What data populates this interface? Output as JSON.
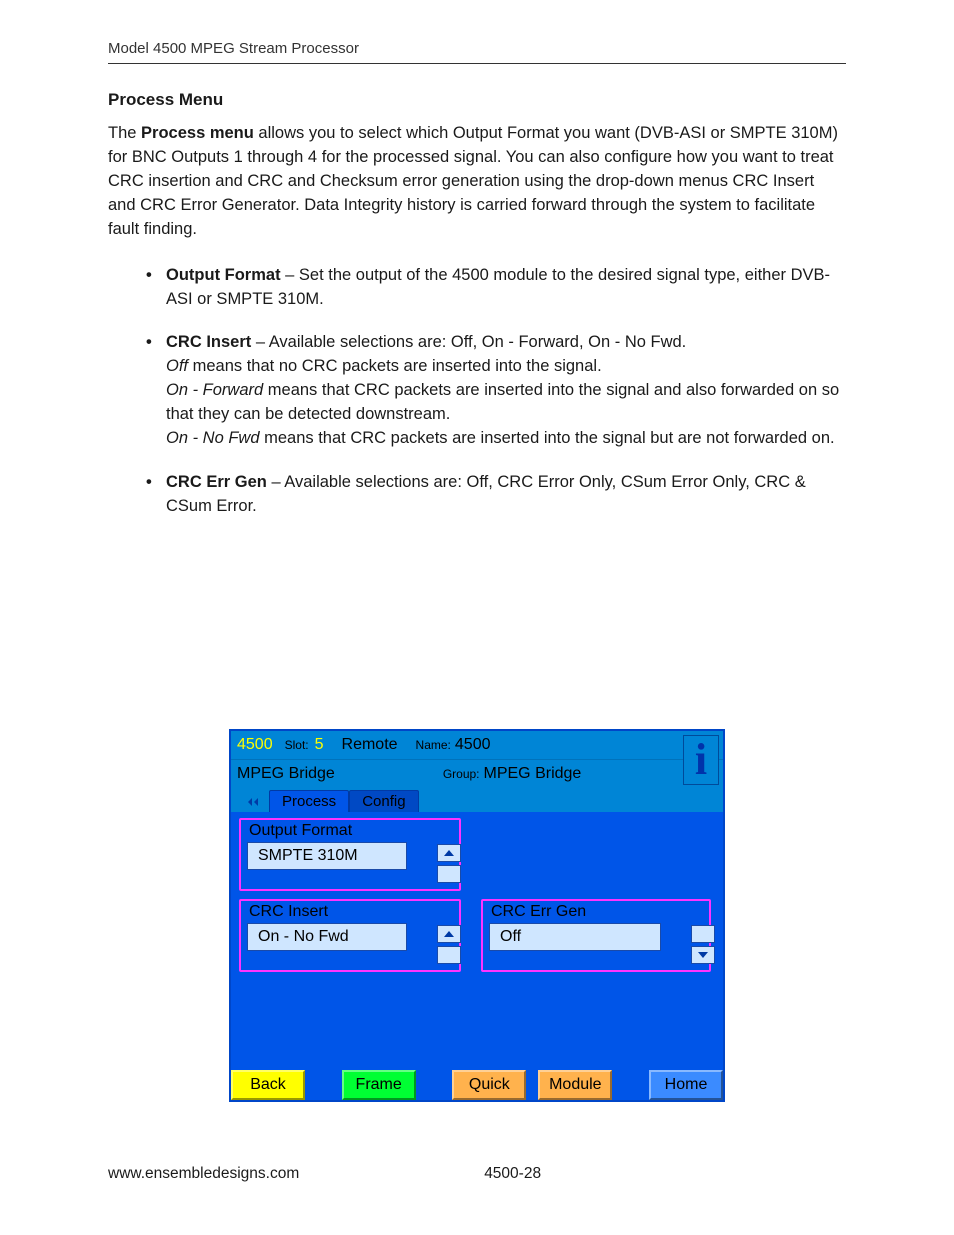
{
  "header": {
    "running_head": "Model 4500 MPEG Stream Processor"
  },
  "section": {
    "title": "Process Menu",
    "intro_pre": "The ",
    "intro_bold": "Process menu",
    "intro_post": " allows you to select which Output Format you want (DVB-ASI or SMPTE 310M) for BNC Outputs 1 through 4 for the processed signal. You can also configure how you want to treat CRC insertion and CRC and Checksum error generation using the drop-down menus CRC Insert and CRC Error Generator. Data Integrity history is carried forward through the system to facilitate fault finding."
  },
  "bullets": {
    "output_format": {
      "term": "Output Format",
      "rest": " – Set the output of the 4500 module to the desired signal type, either DVB-ASI or SMPTE 310M."
    },
    "crc_insert": {
      "term": "CRC Insert",
      "rest": " – Available selections are: Off, On - Forward, On - No Fwd.",
      "l2a_em": "Off",
      "l2a_rest": " means that no CRC packets are inserted into the signal.",
      "l2b_em": "On - Forward",
      "l2b_rest": " means that CRC packets are inserted into the signal and also forwarded on so that they can be detected downstream.",
      "l2c_em": "On - No Fwd",
      "l2c_rest": " means that CRC packets are inserted into the signal but are not forwarded on."
    },
    "crc_err_gen": {
      "term": "CRC Err Gen",
      "rest": " – Available selections are: Off, CRC Error Only, CSum Error Only, CRC & CSum Error."
    }
  },
  "ui": {
    "top": {
      "model": "4500",
      "slot_label": "Slot:",
      "slot_value": "5",
      "remote": "Remote",
      "name_label": "Name:",
      "name_value": "4500",
      "subtitle": "MPEG Bridge",
      "group_label": "Group:",
      "group_value": "MPEG Bridge",
      "info_glyph": "i"
    },
    "tabs": {
      "active": "Process",
      "inactive": "Config"
    },
    "fields": {
      "output_format": {
        "label": "Output Format",
        "value": "SMPTE 310M"
      },
      "crc_insert": {
        "label": "CRC Insert",
        "value": "On - No Fwd"
      },
      "crc_err_gen": {
        "label": "CRC Err Gen",
        "value": "Off"
      }
    },
    "bottom": {
      "back": "Back",
      "frame": "Frame",
      "quick": "Quick",
      "module": "Module",
      "home": "Home"
    }
  },
  "footer": {
    "url": "www.ensembledesigns.com",
    "page": "4500-28"
  }
}
